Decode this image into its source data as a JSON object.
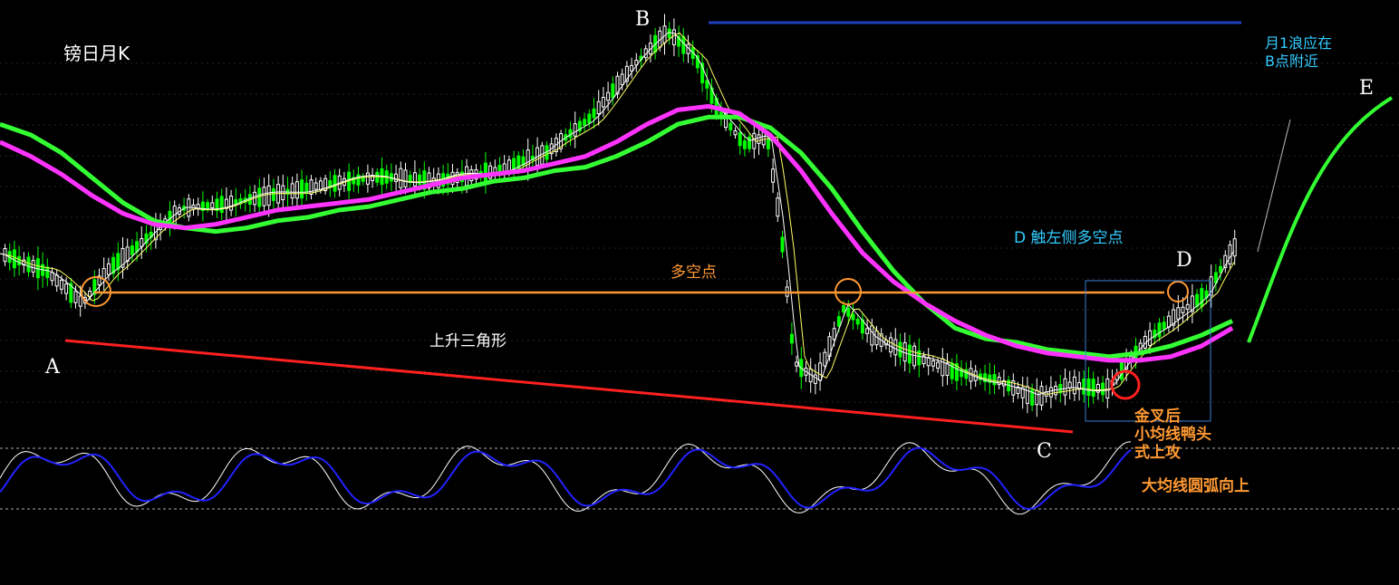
{
  "chart_data": {
    "type": "line",
    "title": "镑日月K",
    "symbol_label": "K",
    "points": {
      "A": "A",
      "B": "B",
      "C": "C",
      "D": "D",
      "E": "E"
    },
    "annotations": {
      "triangle": "上升三角形",
      "longshort": "多空点",
      "d_touch": "D 触左侧多空点",
      "wave_note_1": "月1浪应在",
      "wave_note_2": "B点附近",
      "cross_1": "金叉后",
      "cross_2": "小均线鸭头",
      "cross_3": "式上攻",
      "big_ma": "大均线圆弧向上"
    },
    "colors": {
      "up_candle": "#ffffff",
      "down_candle": "#00ff00",
      "ma_short": "#ffffff",
      "ma_mid": "#ffff66",
      "ma_magenta": "#ff33ff",
      "ma_green": "#33ff33",
      "support_line": "#ff2020",
      "pivot_line": "#ff9933",
      "resistance_line": "#1f3fbf",
      "box": "#3a7fd6",
      "osc_k": "#ffffff",
      "osc_d": "#2222ff",
      "annotation_cyan": "#33ccff",
      "annotation_orange": "#ff9933"
    },
    "grid": true,
    "series": [
      {
        "name": "MA-magenta",
        "values": [
          0.78,
          0.74,
          0.69,
          0.63,
          0.58,
          0.55,
          0.54,
          0.55,
          0.57,
          0.59,
          0.6,
          0.61,
          0.62,
          0.64,
          0.66,
          0.68,
          0.69,
          0.7,
          0.72,
          0.74,
          0.78,
          0.83,
          0.87,
          0.88,
          0.86,
          0.8,
          0.7,
          0.58,
          0.47,
          0.39,
          0.33,
          0.28,
          0.24,
          0.21,
          0.19,
          0.18,
          0.17,
          0.17,
          0.18,
          0.21,
          0.26
        ]
      },
      {
        "name": "MA-green",
        "values": [
          0.83,
          0.8,
          0.75,
          0.68,
          0.61,
          0.56,
          0.54,
          0.53,
          0.54,
          0.56,
          0.57,
          0.59,
          0.6,
          0.62,
          0.64,
          0.65,
          0.67,
          0.68,
          0.7,
          0.71,
          0.74,
          0.78,
          0.83,
          0.85,
          0.85,
          0.82,
          0.75,
          0.65,
          0.53,
          0.42,
          0.33,
          0.26,
          0.23,
          0.22,
          0.2,
          0.19,
          0.18,
          0.19,
          0.21,
          0.24,
          0.28
        ]
      }
    ]
  }
}
